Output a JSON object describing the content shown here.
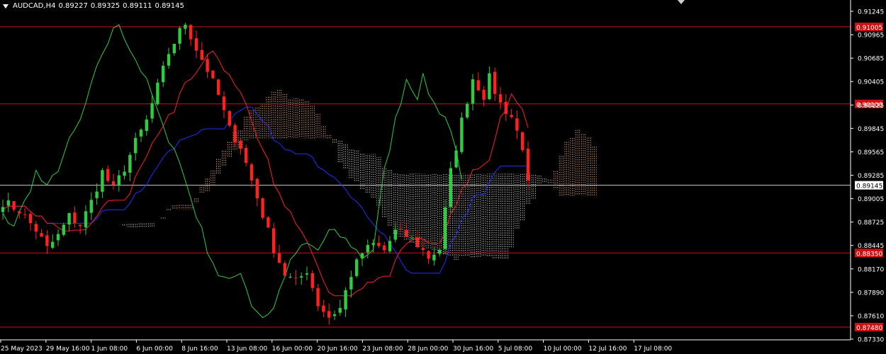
{
  "header": {
    "symbol": "AUDCAD,H4",
    "open": "0.89227",
    "high": "0.89325",
    "low": "0.89111",
    "close": "0.89145"
  },
  "colors": {
    "background": "#000000",
    "bull": "#2ecc40",
    "bear": "#ff2020",
    "level_line": "#d01010",
    "price_line": "#c8c8c8",
    "tenkan": "#ff2020",
    "kijun": "#2030ff",
    "chikou": "#2ecc40",
    "cloud_bull": "#ffbb88",
    "cloud_bear": "#e8e8e8"
  },
  "price_axis": {
    "labels": [
      "0.91245",
      "0.90965",
      "0.90685",
      "0.90405",
      "0.90125",
      "0.89845",
      "0.89565",
      "0.89285",
      "0.89005",
      "0.88725",
      "0.88445",
      "0.88170",
      "0.87890",
      "0.87610",
      "0.87330"
    ]
  },
  "levels": [
    {
      "price": "0.91005",
      "value": 0.91005
    },
    {
      "price": "0.90100",
      "value": 0.901
    },
    {
      "price": "0.88350",
      "value": 0.8835
    },
    {
      "price": "0.87480",
      "value": 0.8748
    }
  ],
  "current_price": {
    "price": "0.89145",
    "value": 0.89145
  },
  "time_axis": {
    "labels": [
      "25 May 2023",
      "29 May 16:00",
      "1 Jun 08:00",
      "6 Jun 00:00",
      "8 Jun 16:00",
      "13 Jun 08:00",
      "16 Jun 00:00",
      "20 Jun 16:00",
      "23 Jun 08:00",
      "28 Jun 00:00",
      "30 Jun 16:00",
      "5 Jul 08:00",
      "10 Jul 00:00",
      "12 Jul 16:00",
      "17 Jul 08:00"
    ]
  },
  "chart_data": {
    "type": "candlestick",
    "y_range": [
      0.8733,
      0.9132
    ],
    "anchors": [
      [
        0,
        0.8895
      ],
      [
        3,
        0.8885
      ],
      [
        6,
        0.8862
      ],
      [
        8,
        0.884
      ],
      [
        10,
        0.8855
      ],
      [
        12,
        0.8878
      ],
      [
        14,
        0.8868
      ],
      [
        16,
        0.8895
      ],
      [
        18,
        0.893
      ],
      [
        20,
        0.891
      ],
      [
        22,
        0.8935
      ],
      [
        24,
        0.8965
      ],
      [
        26,
        0.899
      ],
      [
        28,
        0.903
      ],
      [
        30,
        0.907
      ],
      [
        32,
        0.9095
      ],
      [
        33,
        0.9105
      ],
      [
        35,
        0.9075
      ],
      [
        37,
        0.905
      ],
      [
        39,
        0.902
      ],
      [
        41,
        0.898
      ],
      [
        43,
        0.896
      ],
      [
        45,
        0.892
      ],
      [
        47,
        0.888
      ],
      [
        49,
        0.884
      ],
      [
        51,
        0.881
      ],
      [
        53,
        0.88
      ],
      [
        55,
        0.8815
      ],
      [
        57,
        0.8775
      ],
      [
        59,
        0.876
      ],
      [
        61,
        0.877
      ],
      [
        63,
        0.881
      ],
      [
        65,
        0.8835
      ],
      [
        67,
        0.8845
      ],
      [
        69,
        0.8838
      ],
      [
        71,
        0.886
      ],
      [
        73,
        0.8855
      ],
      [
        75,
        0.8845
      ],
      [
        77,
        0.883
      ],
      [
        79,
        0.884
      ],
      [
        81,
        0.893
      ],
      [
        83,
        0.899
      ],
      [
        85,
        0.904
      ],
      [
        87,
        0.902
      ],
      [
        88,
        0.904
      ],
      [
        90,
        0.901
      ],
      [
        92,
        0.8995
      ],
      [
        94,
        0.896
      ],
      [
        95,
        0.8915
      ]
    ]
  }
}
